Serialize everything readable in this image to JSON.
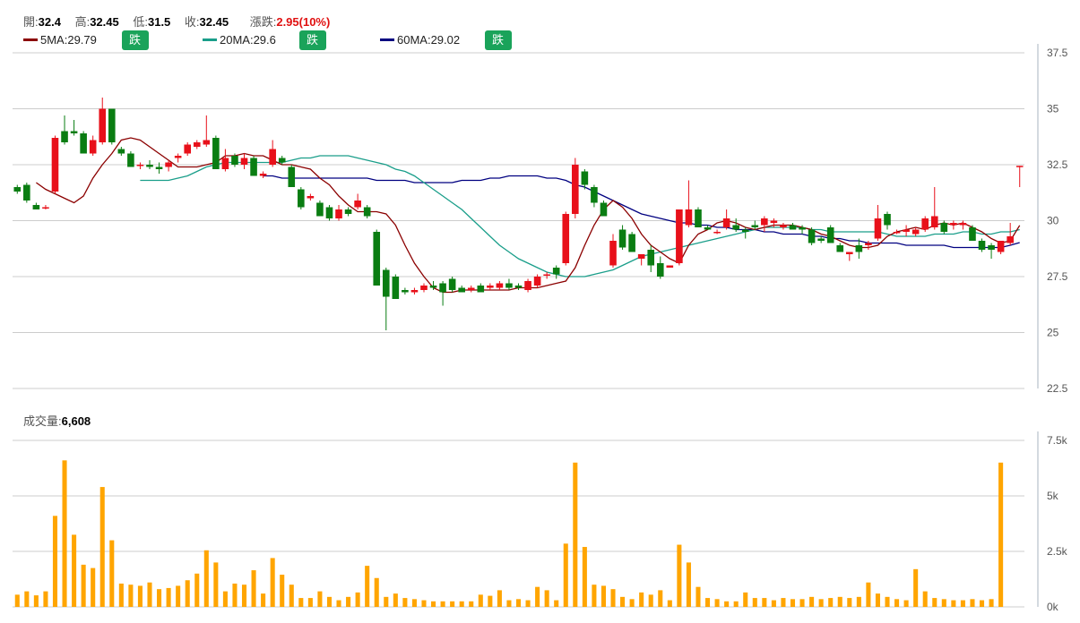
{
  "header": {
    "open_label": "開:",
    "open": "32.4",
    "high_label": "高:",
    "high": "32.45",
    "low_label": "低:",
    "low": "31.5",
    "close_label": "收:",
    "close": "32.45",
    "change_label": "漲跌:",
    "change": "2.95(10%)"
  },
  "ma_legend": [
    {
      "label": "5MA:29.79",
      "color": "#8b0000",
      "button": "跌破 通知"
    },
    {
      "label": "20MA:29.6",
      "color": "#1a9e8a",
      "button": "跌破 通知"
    },
    {
      "label": "60MA:29.02",
      "color": "#000080",
      "button": "跌破 通知"
    }
  ],
  "volume_header": {
    "label": "成交量:",
    "value": "6,608"
  },
  "colors": {
    "up": "#e8101a",
    "down": "#0a7d12",
    "volume": "#ffa500",
    "grid": "#cccccc"
  },
  "chart_data": [
    {
      "type": "candlestick",
      "price_range": [
        22.5,
        37.5
      ],
      "y_ticks": [
        "37.5",
        "35",
        "32.5",
        "30",
        "27.5",
        "25",
        "22.5"
      ],
      "grid": true,
      "candles": [
        {
          "o": 31.5,
          "h": 31.6,
          "l": 31.2,
          "c": 31.3
        },
        {
          "o": 31.6,
          "h": 31.7,
          "l": 30.8,
          "c": 30.9
        },
        {
          "o": 30.7,
          "h": 30.8,
          "l": 30.5,
          "c": 30.5
        },
        {
          "o": 30.6,
          "h": 30.7,
          "l": 30.5,
          "c": 30.6
        },
        {
          "o": 31.3,
          "h": 33.8,
          "l": 31.2,
          "c": 33.7
        },
        {
          "o": 34.0,
          "h": 34.7,
          "l": 33.4,
          "c": 33.5
        },
        {
          "o": 34.0,
          "h": 34.5,
          "l": 33.8,
          "c": 33.9
        },
        {
          "o": 33.9,
          "h": 34.0,
          "l": 33.0,
          "c": 33.0
        },
        {
          "o": 33.0,
          "h": 33.8,
          "l": 32.9,
          "c": 33.6
        },
        {
          "o": 33.5,
          "h": 35.5,
          "l": 33.4,
          "c": 35.0
        },
        {
          "o": 35.0,
          "h": 35.0,
          "l": 33.4,
          "c": 33.5
        },
        {
          "o": 33.2,
          "h": 33.3,
          "l": 32.9,
          "c": 33.0
        },
        {
          "o": 33.0,
          "h": 33.1,
          "l": 32.4,
          "c": 32.4
        },
        {
          "o": 32.5,
          "h": 32.6,
          "l": 32.3,
          "c": 32.5
        },
        {
          "o": 32.5,
          "h": 32.7,
          "l": 32.3,
          "c": 32.4
        },
        {
          "o": 32.4,
          "h": 32.6,
          "l": 32.1,
          "c": 32.3
        },
        {
          "o": 32.4,
          "h": 32.7,
          "l": 32.2,
          "c": 32.6
        },
        {
          "o": 32.8,
          "h": 33.0,
          "l": 32.6,
          "c": 32.9
        },
        {
          "o": 33.0,
          "h": 33.5,
          "l": 32.9,
          "c": 33.4
        },
        {
          "o": 33.3,
          "h": 33.6,
          "l": 33.2,
          "c": 33.5
        },
        {
          "o": 33.4,
          "h": 34.7,
          "l": 33.3,
          "c": 33.6
        },
        {
          "o": 33.7,
          "h": 33.8,
          "l": 32.3,
          "c": 32.3
        },
        {
          "o": 32.3,
          "h": 33.2,
          "l": 32.2,
          "c": 32.8
        },
        {
          "o": 32.9,
          "h": 33.0,
          "l": 32.4,
          "c": 32.5
        },
        {
          "o": 32.5,
          "h": 33.0,
          "l": 32.3,
          "c": 32.8
        },
        {
          "o": 32.8,
          "h": 32.9,
          "l": 32.0,
          "c": 32.0
        },
        {
          "o": 32.0,
          "h": 32.2,
          "l": 31.9,
          "c": 32.1
        },
        {
          "o": 32.5,
          "h": 33.6,
          "l": 32.4,
          "c": 33.2
        },
        {
          "o": 32.8,
          "h": 32.9,
          "l": 32.5,
          "c": 32.6
        },
        {
          "o": 32.4,
          "h": 32.5,
          "l": 31.5,
          "c": 31.5
        },
        {
          "o": 31.4,
          "h": 31.5,
          "l": 30.5,
          "c": 30.6
        },
        {
          "o": 31.0,
          "h": 31.2,
          "l": 30.9,
          "c": 31.1
        },
        {
          "o": 30.8,
          "h": 30.9,
          "l": 30.2,
          "c": 30.2
        },
        {
          "o": 30.6,
          "h": 30.7,
          "l": 30.0,
          "c": 30.1
        },
        {
          "o": 30.1,
          "h": 30.7,
          "l": 30.0,
          "c": 30.5
        },
        {
          "o": 30.5,
          "h": 30.6,
          "l": 30.2,
          "c": 30.3
        },
        {
          "o": 30.6,
          "h": 31.2,
          "l": 30.5,
          "c": 30.9
        },
        {
          "o": 30.6,
          "h": 30.7,
          "l": 30.1,
          "c": 30.2
        },
        {
          "o": 29.5,
          "h": 29.6,
          "l": 27.1,
          "c": 27.1
        },
        {
          "o": 27.8,
          "h": 27.9,
          "l": 25.1,
          "c": 26.6
        },
        {
          "o": 27.5,
          "h": 27.6,
          "l": 26.5,
          "c": 26.5
        },
        {
          "o": 26.9,
          "h": 27.0,
          "l": 26.7,
          "c": 26.8
        },
        {
          "o": 26.8,
          "h": 27.0,
          "l": 26.7,
          "c": 26.9
        },
        {
          "o": 26.9,
          "h": 27.2,
          "l": 26.8,
          "c": 27.1
        },
        {
          "o": 27.1,
          "h": 27.3,
          "l": 26.9,
          "c": 27.0
        },
        {
          "o": 27.2,
          "h": 27.3,
          "l": 26.2,
          "c": 26.8
        },
        {
          "o": 27.4,
          "h": 27.5,
          "l": 26.8,
          "c": 26.9
        },
        {
          "o": 27.0,
          "h": 27.1,
          "l": 26.8,
          "c": 26.8
        },
        {
          "o": 26.9,
          "h": 27.1,
          "l": 26.8,
          "c": 27.0
        },
        {
          "o": 27.1,
          "h": 27.2,
          "l": 26.8,
          "c": 26.8
        },
        {
          "o": 27.0,
          "h": 27.2,
          "l": 26.9,
          "c": 27.1
        },
        {
          "o": 27.0,
          "h": 27.3,
          "l": 26.9,
          "c": 27.2
        },
        {
          "o": 27.2,
          "h": 27.4,
          "l": 26.9,
          "c": 27.0
        },
        {
          "o": 27.1,
          "h": 27.2,
          "l": 26.9,
          "c": 27.0
        },
        {
          "o": 26.9,
          "h": 27.4,
          "l": 26.8,
          "c": 27.3
        },
        {
          "o": 27.1,
          "h": 27.6,
          "l": 27.0,
          "c": 27.5
        },
        {
          "o": 27.6,
          "h": 27.7,
          "l": 27.4,
          "c": 27.6
        },
        {
          "o": 27.9,
          "h": 28.0,
          "l": 27.4,
          "c": 27.6
        },
        {
          "o": 28.1,
          "h": 30.4,
          "l": 28.0,
          "c": 30.3
        },
        {
          "o": 30.3,
          "h": 32.8,
          "l": 30.1,
          "c": 32.5
        },
        {
          "o": 32.2,
          "h": 32.3,
          "l": 31.4,
          "c": 31.6
        },
        {
          "o": 31.5,
          "h": 31.6,
          "l": 30.6,
          "c": 30.8
        },
        {
          "o": 30.8,
          "h": 30.9,
          "l": 30.2,
          "c": 30.2
        },
        {
          "o": 28.0,
          "h": 29.4,
          "l": 27.9,
          "c": 29.1
        },
        {
          "o": 29.6,
          "h": 29.8,
          "l": 28.7,
          "c": 28.8
        },
        {
          "o": 29.4,
          "h": 29.5,
          "l": 28.7,
          "c": 28.6
        },
        {
          "o": 28.3,
          "h": 28.5,
          "l": 28.0,
          "c": 28.5
        },
        {
          "o": 28.7,
          "h": 28.9,
          "l": 27.7,
          "c": 28.0
        },
        {
          "o": 28.1,
          "h": 28.4,
          "l": 27.4,
          "c": 27.5
        },
        {
          "o": 27.9,
          "h": 28.0,
          "l": 27.9,
          "c": 28.0
        },
        {
          "o": 28.1,
          "h": 30.5,
          "l": 28.0,
          "c": 30.5
        },
        {
          "o": 29.8,
          "h": 31.8,
          "l": 29.7,
          "c": 30.5
        },
        {
          "o": 30.5,
          "h": 30.6,
          "l": 29.9,
          "c": 29.7
        },
        {
          "o": 29.7,
          "h": 29.8,
          "l": 29.6,
          "c": 29.6
        },
        {
          "o": 29.5,
          "h": 29.6,
          "l": 29.4,
          "c": 29.5
        },
        {
          "o": 29.7,
          "h": 30.5,
          "l": 29.6,
          "c": 30.1
        },
        {
          "o": 29.8,
          "h": 30.1,
          "l": 29.5,
          "c": 29.6
        },
        {
          "o": 29.6,
          "h": 29.7,
          "l": 29.2,
          "c": 29.5
        },
        {
          "o": 29.8,
          "h": 30.0,
          "l": 29.6,
          "c": 29.7
        },
        {
          "o": 29.8,
          "h": 30.2,
          "l": 29.5,
          "c": 30.1
        },
        {
          "o": 29.9,
          "h": 30.1,
          "l": 29.7,
          "c": 30.0
        },
        {
          "o": 29.7,
          "h": 29.9,
          "l": 29.6,
          "c": 29.8
        },
        {
          "o": 29.8,
          "h": 29.9,
          "l": 29.6,
          "c": 29.6
        },
        {
          "o": 29.7,
          "h": 29.8,
          "l": 29.4,
          "c": 29.6
        },
        {
          "o": 29.6,
          "h": 29.7,
          "l": 28.9,
          "c": 29.0
        },
        {
          "o": 29.2,
          "h": 29.3,
          "l": 29.0,
          "c": 29.1
        },
        {
          "o": 29.7,
          "h": 29.8,
          "l": 29.0,
          "c": 29.0
        },
        {
          "o": 28.9,
          "h": 29.0,
          "l": 28.6,
          "c": 28.6
        },
        {
          "o": 28.5,
          "h": 28.6,
          "l": 28.2,
          "c": 28.6
        },
        {
          "o": 28.9,
          "h": 29.2,
          "l": 28.3,
          "c": 28.6
        },
        {
          "o": 28.9,
          "h": 29.1,
          "l": 28.7,
          "c": 29.0
        },
        {
          "o": 29.2,
          "h": 30.7,
          "l": 29.1,
          "c": 30.1
        },
        {
          "o": 30.3,
          "h": 30.4,
          "l": 29.6,
          "c": 29.8
        },
        {
          "o": 29.5,
          "h": 29.6,
          "l": 29.4,
          "c": 29.5
        },
        {
          "o": 29.5,
          "h": 29.8,
          "l": 29.3,
          "c": 29.6
        },
        {
          "o": 29.4,
          "h": 29.7,
          "l": 29.3,
          "c": 29.6
        },
        {
          "o": 29.6,
          "h": 30.2,
          "l": 29.5,
          "c": 30.1
        },
        {
          "o": 29.7,
          "h": 31.5,
          "l": 29.6,
          "c": 30.2
        },
        {
          "o": 29.9,
          "h": 30.0,
          "l": 29.4,
          "c": 29.5
        },
        {
          "o": 29.8,
          "h": 30.0,
          "l": 29.6,
          "c": 29.9
        },
        {
          "o": 29.8,
          "h": 30.0,
          "l": 29.6,
          "c": 29.9
        },
        {
          "o": 29.7,
          "h": 29.8,
          "l": 29.1,
          "c": 29.1
        },
        {
          "o": 29.1,
          "h": 29.2,
          "l": 28.6,
          "c": 28.7
        },
        {
          "o": 28.9,
          "h": 29.0,
          "l": 28.3,
          "c": 28.7
        },
        {
          "o": 28.6,
          "h": 29.1,
          "l": 28.5,
          "c": 29.1
        },
        {
          "o": 29.0,
          "h": 29.9,
          "l": 28.9,
          "c": 29.3
        },
        {
          "o": 32.4,
          "h": 32.45,
          "l": 31.5,
          "c": 32.45
        }
      ],
      "ma5": [
        31.7,
        31.4,
        31.2,
        31.0,
        30.8,
        31.1,
        31.9,
        32.5,
        33.0,
        33.6,
        33.7,
        33.6,
        33.3,
        33.0,
        32.7,
        32.4,
        32.4,
        32.4,
        32.5,
        32.6,
        32.9,
        32.9,
        33.0,
        32.9,
        32.9,
        32.7,
        32.5,
        32.5,
        32.4,
        32.3,
        31.9,
        31.6,
        31.1,
        30.7,
        30.4,
        30.4,
        30.4,
        30.3,
        29.8,
        28.9,
        28.1,
        27.5,
        27.0,
        26.8,
        26.8,
        26.9,
        26.9,
        26.9,
        26.9,
        26.9,
        26.9,
        27.0,
        27.0,
        27.0,
        27.1,
        27.2,
        27.3,
        27.9,
        28.9,
        29.8,
        30.5,
        30.9,
        30.6,
        30.1,
        29.4,
        28.9,
        28.6,
        28.3,
        28.1,
        28.9,
        29.4,
        29.6,
        29.9,
        30.0,
        29.9,
        29.7,
        29.6,
        29.7,
        29.8,
        29.8,
        29.8,
        29.7,
        29.6,
        29.4,
        29.3,
        29.1,
        28.9,
        28.8,
        28.8,
        28.9,
        29.3,
        29.5,
        29.6,
        29.7,
        29.6,
        29.8,
        29.9,
        29.8,
        29.9,
        29.7,
        29.5,
        29.2,
        29.0,
        29.1,
        29.79
      ],
      "ma20": [
        31.8,
        31.8,
        31.8,
        31.8,
        31.9,
        32.0,
        32.2,
        32.4,
        32.5,
        32.6,
        32.6,
        32.6,
        32.6,
        32.6,
        32.6,
        32.6,
        32.7,
        32.8,
        32.8,
        32.9,
        32.9,
        32.9,
        32.9,
        32.8,
        32.7,
        32.6,
        32.5,
        32.3,
        32.2,
        32.0,
        31.7,
        31.4,
        31.1,
        30.8,
        30.5,
        30.1,
        29.7,
        29.3,
        28.9,
        28.6,
        28.3,
        28.1,
        27.9,
        27.7,
        27.6,
        27.5,
        27.5,
        27.5,
        27.6,
        27.7,
        27.8,
        28.0,
        28.2,
        28.4,
        28.5,
        28.6,
        28.7,
        28.8,
        28.9,
        29.0,
        29.1,
        29.2,
        29.3,
        29.4,
        29.5,
        29.6,
        29.7,
        29.7,
        29.7,
        29.7,
        29.7,
        29.6,
        29.6,
        29.5,
        29.5,
        29.5,
        29.5,
        29.5,
        29.5,
        29.4,
        29.3,
        29.3,
        29.3,
        29.3,
        29.4,
        29.4,
        29.4,
        29.5,
        29.5,
        29.4,
        29.4,
        29.5,
        29.5,
        29.6
      ],
      "ma60": [
        32.0,
        32.0,
        31.9,
        31.9,
        31.9,
        31.9,
        31.9,
        31.9,
        31.9,
        31.9,
        31.9,
        31.9,
        31.8,
        31.8,
        31.8,
        31.8,
        31.7,
        31.7,
        31.7,
        31.7,
        31.7,
        31.8,
        31.8,
        31.8,
        31.9,
        31.9,
        32.0,
        32.0,
        32.0,
        32.0,
        31.9,
        31.9,
        31.8,
        31.6,
        31.5,
        31.3,
        31.1,
        30.9,
        30.7,
        30.5,
        30.3,
        30.2,
        30.1,
        30.0,
        29.9,
        29.9,
        29.8,
        29.8,
        29.7,
        29.7,
        29.6,
        29.6,
        29.6,
        29.5,
        29.5,
        29.4,
        29.4,
        29.4,
        29.3,
        29.3,
        29.2,
        29.2,
        29.1,
        29.1,
        29.0,
        29.0,
        29.0,
        29.0,
        28.9,
        28.9,
        28.9,
        28.9,
        28.9,
        28.8,
        28.8,
        28.8,
        28.8,
        28.8,
        28.8,
        28.9,
        29.02
      ]
    },
    {
      "type": "bar",
      "name": "成交量",
      "y_range": [
        0,
        7500
      ],
      "y_ticks": [
        "7.5k",
        "5k",
        "2.5k",
        "0k"
      ],
      "grid": true,
      "values": [
        550,
        700,
        520,
        700,
        4100,
        6600,
        3250,
        1900,
        1750,
        5400,
        3000,
        1050,
        1000,
        950,
        1100,
        800,
        850,
        950,
        1200,
        1500,
        2550,
        2000,
        700,
        1050,
        1000,
        1650,
        600,
        2200,
        1450,
        1000,
        400,
        400,
        700,
        450,
        300,
        450,
        650,
        1850,
        1300,
        450,
        600,
        400,
        350,
        300,
        250,
        250,
        250,
        250,
        250,
        550,
        500,
        750,
        300,
        350,
        300,
        900,
        750,
        300,
        2850,
        6500,
        2700,
        1000,
        950,
        800,
        450,
        350,
        650,
        550,
        750,
        300,
        2800,
        2000,
        900,
        400,
        350,
        250,
        250,
        650,
        400,
        400,
        300,
        400,
        350,
        350,
        450,
        350,
        400,
        450,
        400,
        450,
        1100,
        600,
        450,
        350,
        300,
        1700,
        700,
        400,
        350,
        300,
        300,
        350,
        300,
        350,
        6500
      ]
    }
  ]
}
